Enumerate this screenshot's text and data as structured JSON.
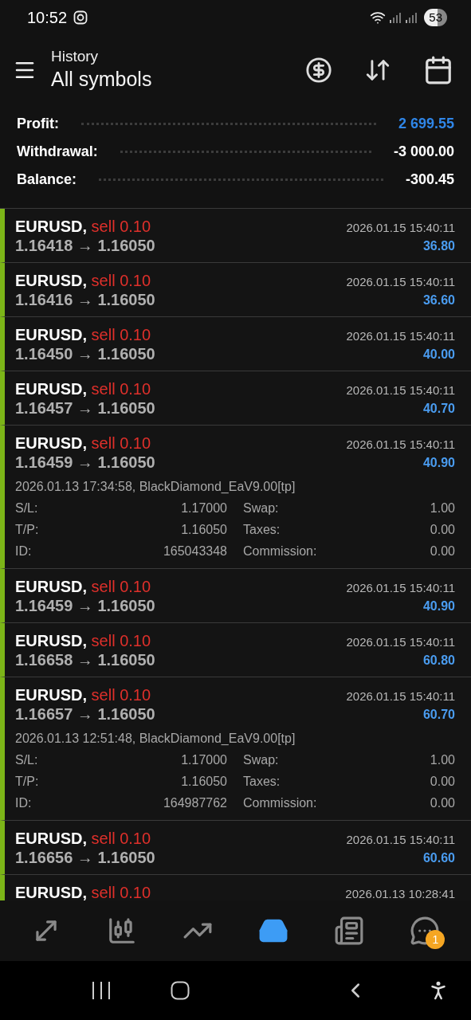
{
  "status_bar": {
    "time": "10:52",
    "battery": "53"
  },
  "header": {
    "section": "History",
    "title": "All symbols"
  },
  "summary": [
    {
      "label": "Profit:",
      "value": "2 699.55",
      "kind": "positive"
    },
    {
      "label": "Withdrawal:",
      "value": "-3 000.00",
      "kind": "plain"
    },
    {
      "label": "Balance:",
      "value": "-300.45",
      "kind": "plain"
    }
  ],
  "deals": [
    {
      "symbol": "EURUSD,",
      "action": "sell 0.10",
      "prices": "1.16418 → 1.16050",
      "time": "2026.01.15 15:40:11",
      "profit": "36.80",
      "expanded": false
    },
    {
      "symbol": "EURUSD,",
      "action": "sell 0.10",
      "prices": "1.16416 → 1.16050",
      "time": "2026.01.15 15:40:11",
      "profit": "36.60",
      "expanded": false
    },
    {
      "symbol": "EURUSD,",
      "action": "sell 0.10",
      "prices": "1.16450 → 1.16050",
      "time": "2026.01.15 15:40:11",
      "profit": "40.00",
      "expanded": false
    },
    {
      "symbol": "EURUSD,",
      "action": "sell 0.10",
      "prices": "1.16457 → 1.16050",
      "time": "2026.01.15 15:40:11",
      "profit": "40.70",
      "expanded": false
    },
    {
      "symbol": "EURUSD,",
      "action": "sell 0.10",
      "prices": "1.16459 → 1.16050",
      "time": "2026.01.15 15:40:11",
      "profit": "40.90",
      "expanded": true,
      "details": {
        "opened": "2026.01.13 17:34:58, BlackDiamond_EaV9.00[tp]",
        "fields": [
          [
            "S/L:",
            "1.17000",
            "Swap:",
            "1.00"
          ],
          [
            "T/P:",
            "1.16050",
            "Taxes:",
            "0.00"
          ],
          [
            "ID:",
            "165043348",
            "Commission:",
            "0.00"
          ]
        ]
      }
    },
    {
      "symbol": "EURUSD,",
      "action": "sell 0.10",
      "prices": "1.16459 → 1.16050",
      "time": "2026.01.15 15:40:11",
      "profit": "40.90",
      "expanded": false
    },
    {
      "symbol": "EURUSD,",
      "action": "sell 0.10",
      "prices": "1.16658 → 1.16050",
      "time": "2026.01.15 15:40:11",
      "profit": "60.80",
      "expanded": false
    },
    {
      "symbol": "EURUSD,",
      "action": "sell 0.10",
      "prices": "1.16657 → 1.16050",
      "time": "2026.01.15 15:40:11",
      "profit": "60.70",
      "expanded": true,
      "details": {
        "opened": "2026.01.13 12:51:48, BlackDiamond_EaV9.00[tp]",
        "fields": [
          [
            "S/L:",
            "1.17000",
            "Swap:",
            "1.00"
          ],
          [
            "T/P:",
            "1.16050",
            "Taxes:",
            "0.00"
          ],
          [
            "ID:",
            "164987762",
            "Commission:",
            "0.00"
          ]
        ]
      }
    },
    {
      "symbol": "EURUSD,",
      "action": "sell 0.10",
      "prices": "1.16656 → 1.16050",
      "time": "2026.01.15 15:40:11",
      "profit": "60.60",
      "expanded": false
    },
    {
      "symbol": "EURUSD,",
      "action": "sell 0.10",
      "time": "2026.01.13 10:28:41",
      "expanded": false
    }
  ],
  "bottom_nav": [
    {
      "kind": "trade",
      "selected": false
    },
    {
      "kind": "quotes",
      "selected": false
    },
    {
      "kind": "chart",
      "selected": false
    },
    {
      "kind": "history",
      "selected": true
    },
    {
      "kind": "news",
      "selected": false
    },
    {
      "kind": "chat",
      "selected": false,
      "badge": "1"
    }
  ]
}
